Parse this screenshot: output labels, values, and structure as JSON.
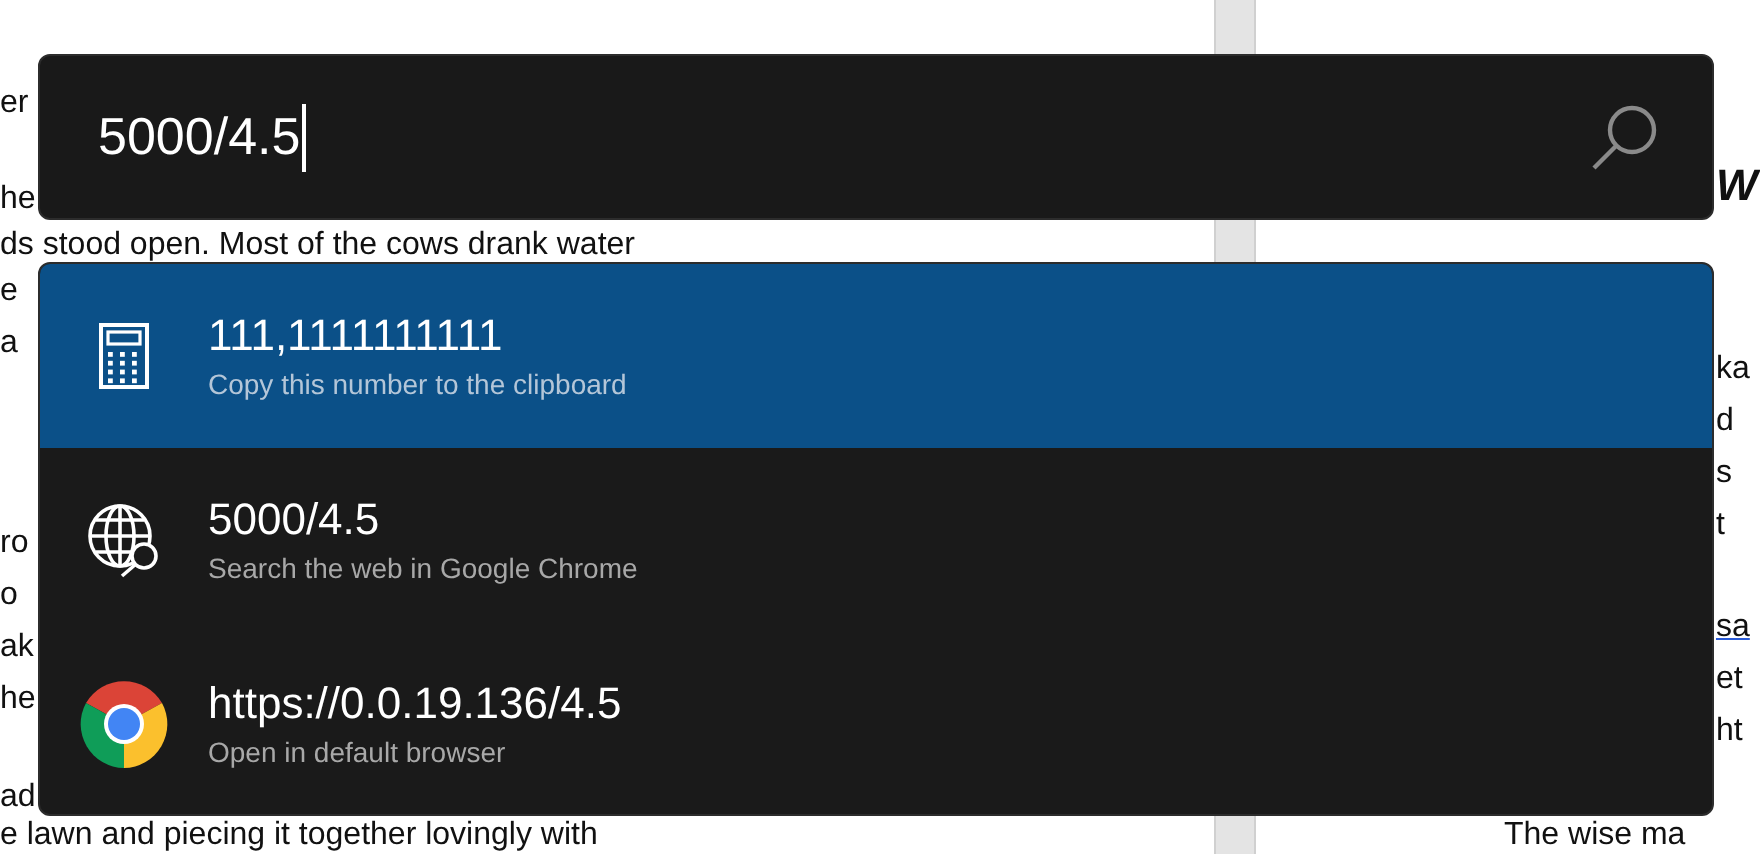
{
  "document": {
    "left_paragraphs": [
      [
        "er"
      ],
      [
        "he",
        "ds stood open. Most of the cows drank water",
        "e",
        "a"
      ],
      [
        "ro",
        "o",
        "ak",
        "he"
      ],
      [
        "ad",
        "e lawn and piecing it together lovingly with"
      ]
    ],
    "right_heading": "W",
    "right_paragraphs": [
      [
        {
          "text": "ka",
          "link": false
        },
        {
          "text": "d",
          "link": false
        },
        {
          "text": "s",
          "link": false
        },
        {
          "text": "t",
          "link": false
        }
      ],
      [
        {
          "text": "sa",
          "link": true
        },
        {
          "text": "et",
          "link": false
        },
        {
          "text": "ht",
          "link": false
        }
      ],
      [
        {
          "text": "The wise ma",
          "link": false
        }
      ]
    ]
  },
  "launcher": {
    "query": "5000/4.5",
    "results": [
      {
        "kind": "calculator",
        "title": "111,1111111111",
        "subtitle": "Copy this number to the clipboard",
        "selected": true
      },
      {
        "kind": "web_search",
        "title": "5000/4.5",
        "subtitle": "Search the web in Google Chrome",
        "selected": false
      },
      {
        "kind": "browser",
        "title": "https://0.0.19.136/4.5",
        "subtitle": "Open in default browser",
        "selected": false
      }
    ]
  }
}
